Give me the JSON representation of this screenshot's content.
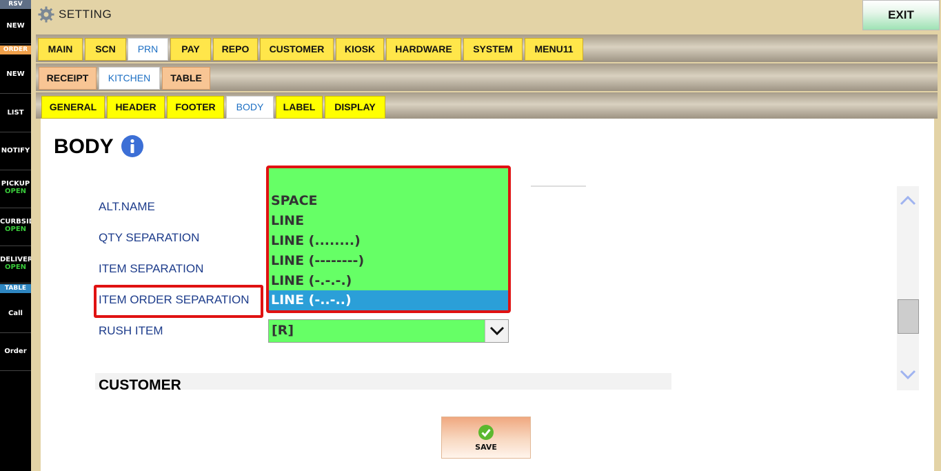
{
  "sidebar": {
    "rsv_header": "RSV",
    "order_header": "ORDER",
    "table_header": "TABLE",
    "items": [
      {
        "label": "NEW",
        "sub": ""
      },
      {
        "label": "NEW",
        "sub": ""
      },
      {
        "label": "LIST",
        "sub": ""
      },
      {
        "label": "NOTIFY",
        "sub": ""
      },
      {
        "label": "PICKUP",
        "sub": "OPEN"
      },
      {
        "label": "CURBSID",
        "sub": "OPEN"
      },
      {
        "label": "DELIVER",
        "sub": "OPEN"
      },
      {
        "label": "Call",
        "sub": ""
      },
      {
        "label": "Order",
        "sub": ""
      }
    ]
  },
  "header": {
    "title": "SETTING",
    "exit_label": "EXIT"
  },
  "tabs_main": [
    "MAIN",
    "SCN",
    "PRN",
    "PAY",
    "REPO",
    "CUSTOMER",
    "KIOSK",
    "HARDWARE",
    "SYSTEM",
    "MENU11"
  ],
  "tabs_main_active": "PRN",
  "tabs_prn": [
    "RECEIPT",
    "KITCHEN",
    "TABLE"
  ],
  "tabs_prn_active": "KITCHEN",
  "tabs_kitchen": [
    "GENERAL",
    "HEADER",
    "FOOTER",
    "BODY",
    "LABEL",
    "DISPLAY"
  ],
  "tabs_kitchen_active": "BODY",
  "section": {
    "title": "BODY",
    "info_icon": "info-icon"
  },
  "rows": {
    "alt_name": "ALT.NAME",
    "qty_separation": "QTY SEPARATION",
    "item_separation": "ITEM SEPARATION",
    "item_order_separation": "ITEM ORDER SEPARATION",
    "rush_item": "RUSH ITEM"
  },
  "dropdown": {
    "options": [
      "SPACE",
      "LINE",
      "LINE (........)",
      "LINE (--------)",
      "LINE (-.-.-.)",
      "LINE (-..-..)"
    ],
    "selected": "LINE (-..-..)"
  },
  "rush_item_value": "[R]",
  "customer_section": "CUSTOMER",
  "save_label": "SAVE",
  "colors": {
    "accent_green": "#66ff66",
    "highlight_red": "#e01212",
    "selected_blue": "#2b9fd8",
    "tab_active_text": "#1c6fc4",
    "label_blue": "#1d3c8b",
    "status_open": "#39c93a"
  }
}
